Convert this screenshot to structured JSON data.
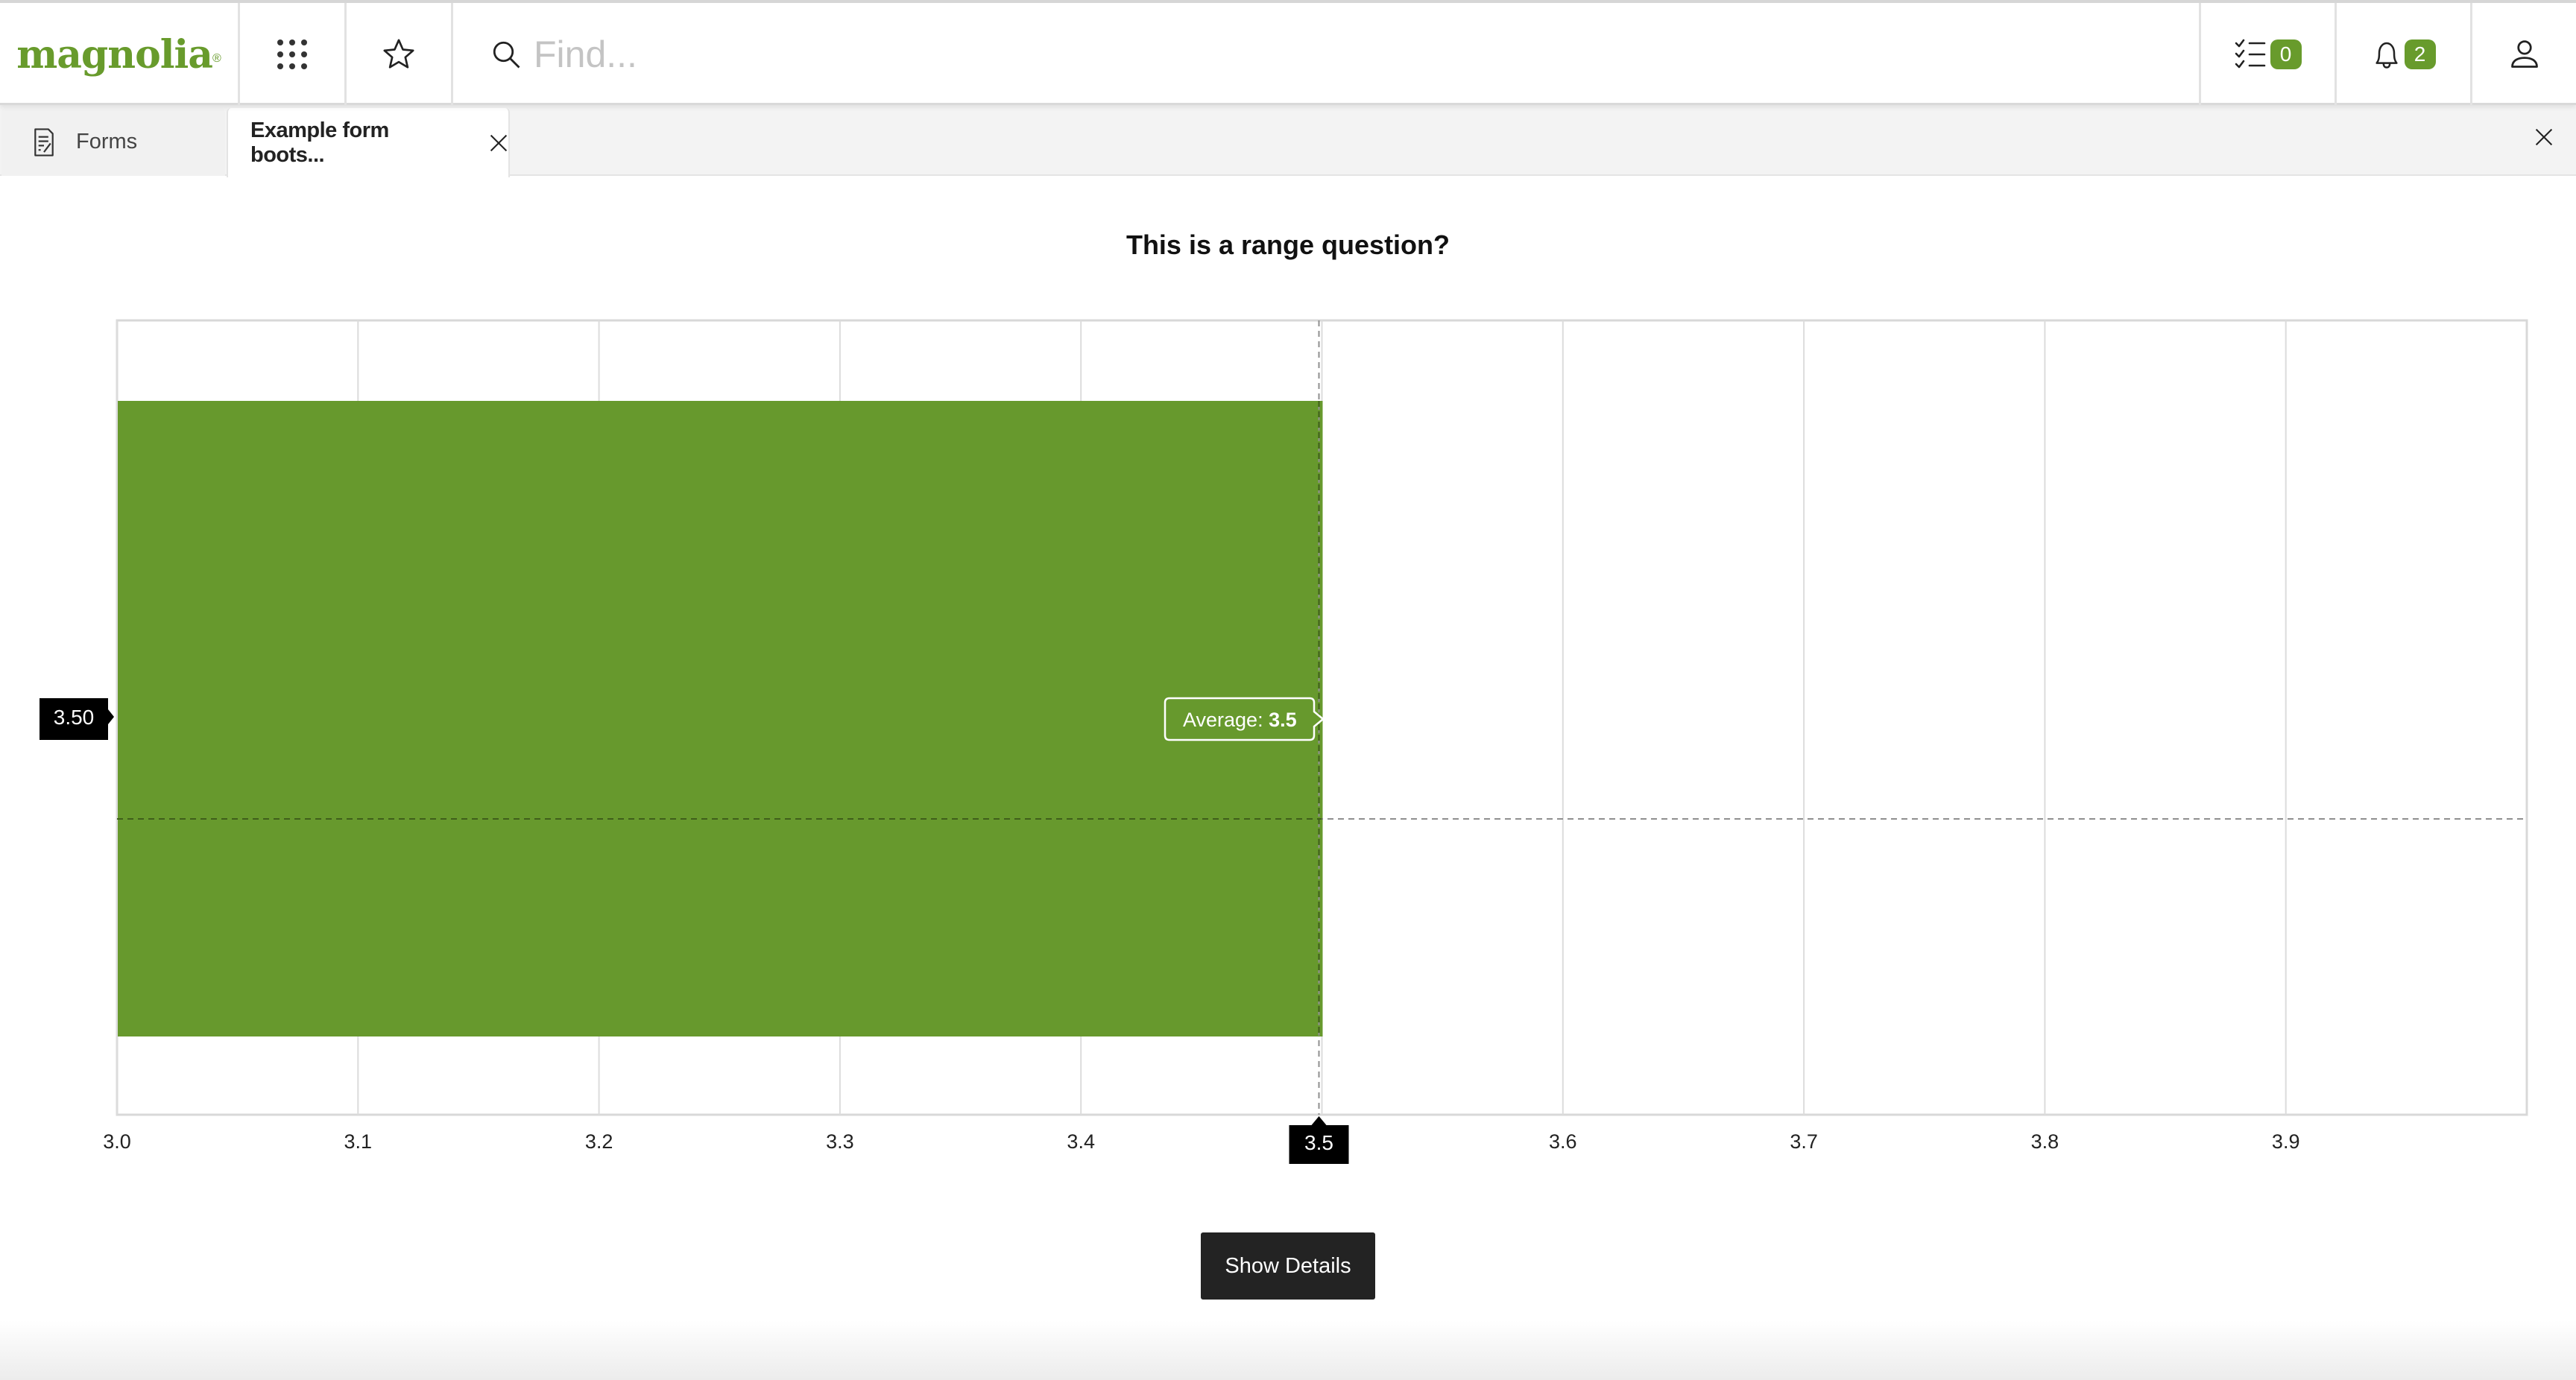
{
  "header": {
    "logo_text": "magnolia",
    "logo_mark": "®",
    "apps_icon": "grid-dots-icon",
    "favorites_icon": "star-icon",
    "search": {
      "icon": "search-icon",
      "placeholder": "Find...",
      "value": ""
    },
    "tasks": {
      "icon": "checklist-icon",
      "count": "0"
    },
    "notifications": {
      "icon": "bell-icon",
      "count": "2"
    },
    "user_icon": "user-icon"
  },
  "tabs": [
    {
      "label": "Forms",
      "icon": "form-document-icon",
      "active": false
    },
    {
      "label": "Example form boots...",
      "active": true,
      "closable": true
    }
  ],
  "colors": {
    "brand": "#689b2c",
    "bar": "#67992d",
    "tooltip_dark": "#000000",
    "button_dark": "#232323"
  },
  "chart_data": {
    "type": "bar",
    "orientation": "horizontal",
    "title": "This is a range question?",
    "categories": [
      ""
    ],
    "values": [
      3.5
    ],
    "xlabel": "",
    "ylabel": "",
    "xlim": [
      3.0,
      4.0
    ],
    "x_ticks": [
      "3.0",
      "3.1",
      "3.2",
      "3.3",
      "3.4",
      "3.5",
      "3.6",
      "3.7",
      "3.8",
      "3.9"
    ],
    "grid": true,
    "crosshair": {
      "x_value": 3.5,
      "x_label": "3.5",
      "y_label": "3.50"
    },
    "tooltip": {
      "label": "Average:",
      "value": "3.5"
    }
  },
  "actions": {
    "show_details_label": "Show Details"
  }
}
